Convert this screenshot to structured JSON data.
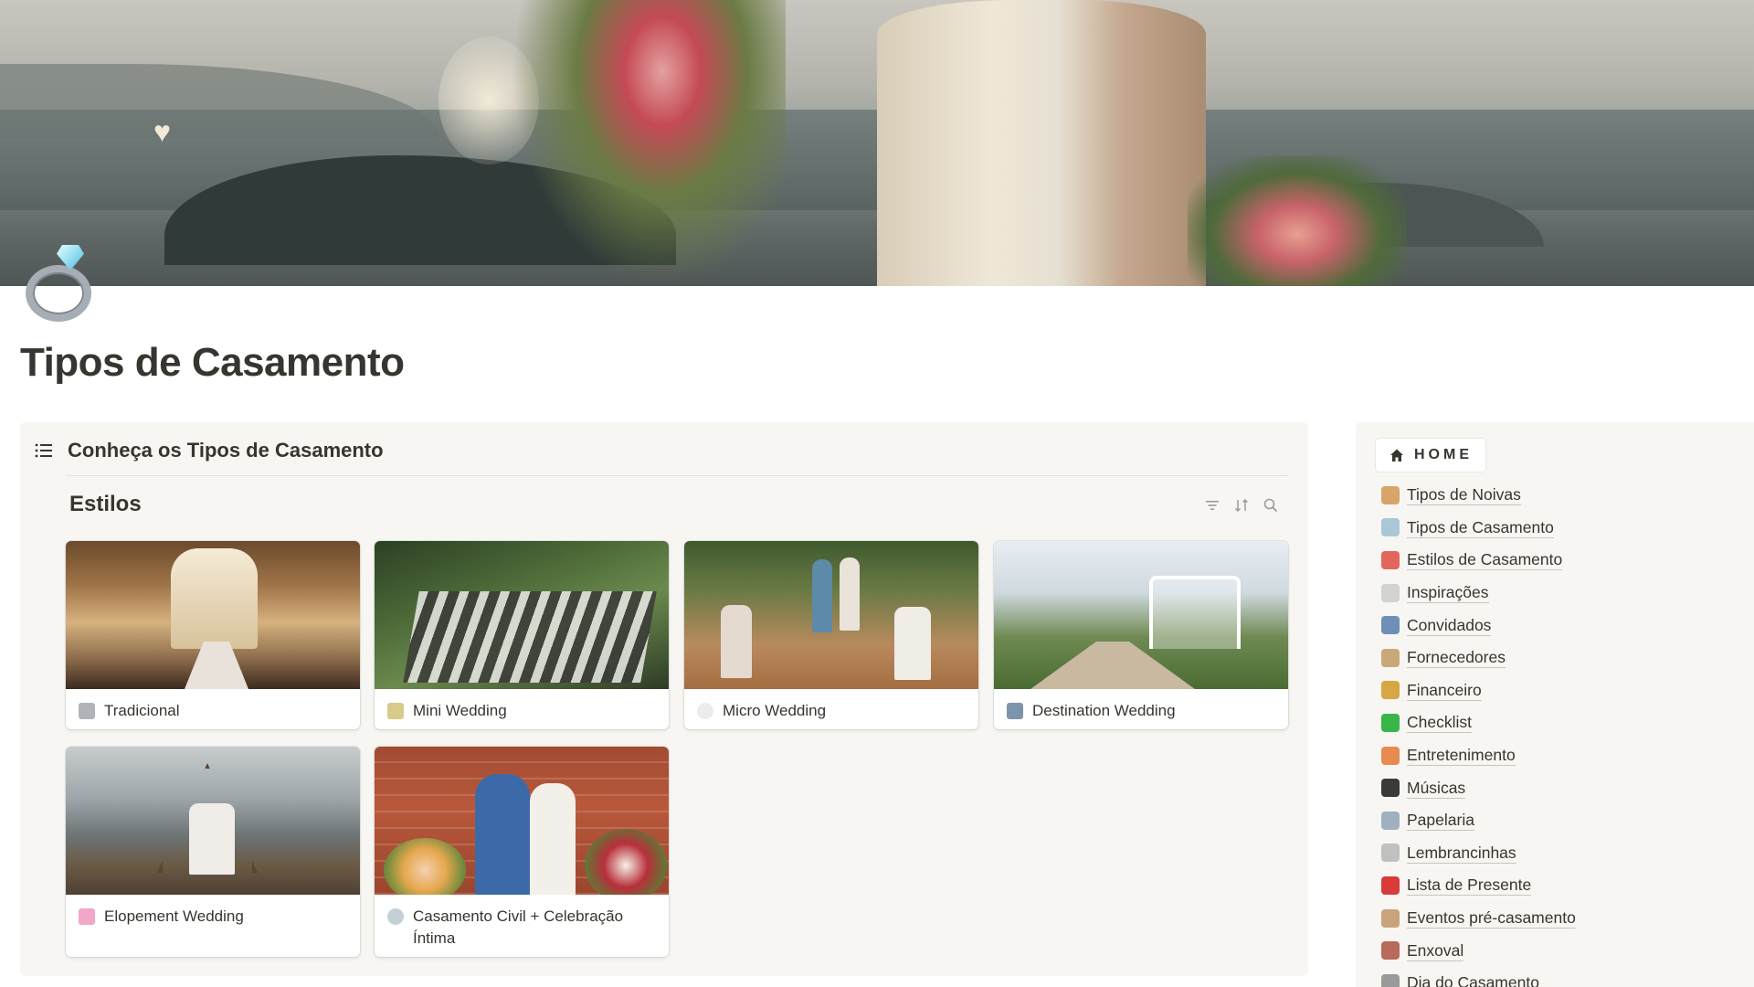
{
  "page": {
    "title": "Tipos de Casamento",
    "icon": "ring-icon"
  },
  "toggle": {
    "title": "Conheça os Tipos de Casamento",
    "icon": "list-icon"
  },
  "database": {
    "title": "Estilos",
    "tools": [
      "filter-icon",
      "sort-icon",
      "search-icon"
    ],
    "cards": [
      {
        "label": "Tradicional",
        "icon": "church-icon"
      },
      {
        "label": "Mini Wedding",
        "icon": "champagne-icon"
      },
      {
        "label": "Micro Wedding",
        "icon": "white-heart-icon"
      },
      {
        "label": "Destination Wedding",
        "icon": "airplane-icon"
      },
      {
        "label": "Elopement Wedding",
        "icon": "bouquet-icon"
      },
      {
        "label": "Casamento Civil + Celebração Íntima",
        "icon": "ring-icon"
      }
    ]
  },
  "sidebar": {
    "home_label": "HOME",
    "home_icon": "house-icon",
    "items": [
      {
        "label": "Tipos de Noivas",
        "icon": "bride-icon",
        "color": "#d9a46a"
      },
      {
        "label": "Tipos de Casamento",
        "icon": "ring-icon",
        "color": "#a9c7d6"
      },
      {
        "label": "Estilos de Casamento",
        "icon": "bouquet-icon",
        "color": "#e2675a"
      },
      {
        "label": "Inspirações",
        "icon": "thought-bubble-icon",
        "color": "#d2d2d2"
      },
      {
        "label": "Convidados",
        "icon": "people-icon",
        "color": "#6f8fb6"
      },
      {
        "label": "Fornecedores",
        "icon": "clipboard-icon",
        "color": "#c9a97a"
      },
      {
        "label": "Financeiro",
        "icon": "money-bag-icon",
        "color": "#d6a742"
      },
      {
        "label": "Checklist",
        "icon": "check-box-icon",
        "color": "#3ab54a"
      },
      {
        "label": "Entretenimento",
        "icon": "party-popper-icon",
        "color": "#e98b4f"
      },
      {
        "label": "Músicas",
        "icon": "music-notes-icon",
        "color": "#3a3a3a"
      },
      {
        "label": "Papelaria",
        "icon": "pen-icon",
        "color": "#9fb0bf"
      },
      {
        "label": "Lembrancinhas",
        "icon": "gift-icon",
        "color": "#c0c0c0"
      },
      {
        "label": "Lista de Presente",
        "icon": "present-icon",
        "color": "#d93b3b"
      },
      {
        "label": "Eventos pré-casamento",
        "icon": "champagne-icon",
        "color": "#c9a37a"
      },
      {
        "label": "Enxoval",
        "icon": "bed-icon",
        "color": "#b86a5b"
      },
      {
        "label": "Dia do Casamento",
        "icon": "church-icon",
        "color": "#9a9a9a"
      }
    ]
  }
}
